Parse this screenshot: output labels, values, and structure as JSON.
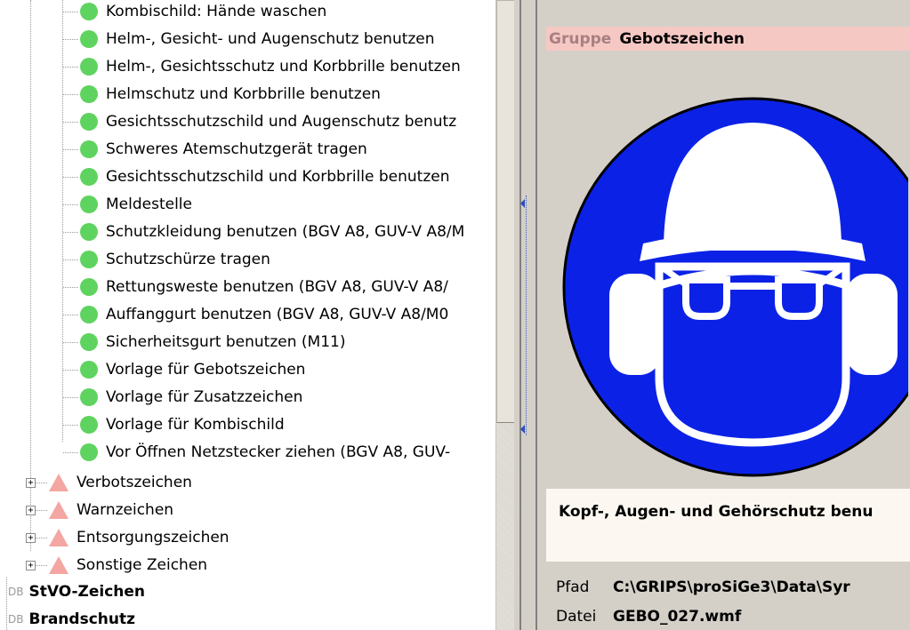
{
  "tree": {
    "items": [
      {
        "label": "Kombischild: Hände waschen",
        "icon": "green-dot-icon"
      },
      {
        "label": "Helm-, Gesicht- und Augenschutz benutzen",
        "icon": "green-dot-icon"
      },
      {
        "label": "Helm-, Gesichtsschutz und Korbbrille benutzen",
        "icon": "green-dot-icon"
      },
      {
        "label": "Helmschutz und Korbbrille benutzen",
        "icon": "green-dot-icon"
      },
      {
        "label": "Gesichtsschutzschild und Augenschutz benutz",
        "icon": "green-dot-icon"
      },
      {
        "label": "Schweres Atemschutzgerät tragen",
        "icon": "green-dot-icon"
      },
      {
        "label": "Gesichtsschutzschild und Korbbrille benutzen",
        "icon": "green-dot-icon"
      },
      {
        "label": "Meldestelle",
        "icon": "green-dot-icon"
      },
      {
        "label": "Schutzkleidung benutzen (BGV A8, GUV-V A8/M",
        "icon": "green-dot-icon"
      },
      {
        "label": "Schutzschürze tragen",
        "icon": "green-dot-icon"
      },
      {
        "label": "Rettungsweste benutzen (BGV A8, GUV-V A8/",
        "icon": "green-dot-icon"
      },
      {
        "label": "Auffanggurt benutzen (BGV A8, GUV-V A8/M0",
        "icon": "green-dot-icon"
      },
      {
        "label": "Sicherheitsgurt benutzen (M11)",
        "icon": "green-dot-icon"
      },
      {
        "label": "Vorlage für Gebotszeichen",
        "icon": "green-dot-icon"
      },
      {
        "label": "Vorlage für Zusatzzeichen",
        "icon": "green-dot-icon"
      },
      {
        "label": "Vorlage für Kombischild",
        "icon": "green-dot-icon"
      },
      {
        "label": "Vor Öffnen Netzstecker ziehen (BGV A8, GUV-",
        "icon": "green-dot-icon"
      }
    ],
    "categories": [
      {
        "label": "Verbotszeichen",
        "expander": "+",
        "icon": "pink-triangle-icon"
      },
      {
        "label": "Warnzeichen",
        "expander": "+",
        "icon": "pink-triangle-icon"
      },
      {
        "label": "Entsorgungszeichen",
        "expander": "+",
        "icon": "pink-triangle-icon"
      },
      {
        "label": "Sonstige Zeichen",
        "expander": "+",
        "icon": "pink-triangle-icon"
      }
    ],
    "databases": [
      {
        "prefix": "DB",
        "label": "StVO-Zeichen"
      },
      {
        "prefix": "DB",
        "label": "Brandschutz"
      }
    ]
  },
  "detail": {
    "group_label": "Gruppe",
    "group_value": "Gebotszeichen",
    "sign_icon": "head-eye-ear-protection-sign-icon",
    "caption": "Kopf-, Augen- und Gehörschutz benu",
    "path_label": "Pfad",
    "path_value": "C:\\GRIPS\\proSiGe3\\Data\\Syr",
    "file_label": "Datei",
    "file_value": "GEBO_027.wmf"
  },
  "colors": {
    "accent_blue": "#0b22e6",
    "leaf_green": "#5fd35f",
    "category_pink": "#f4a6a2",
    "group_row_bg": "#f6c8c4",
    "window_bg": "#d4d0c8"
  }
}
